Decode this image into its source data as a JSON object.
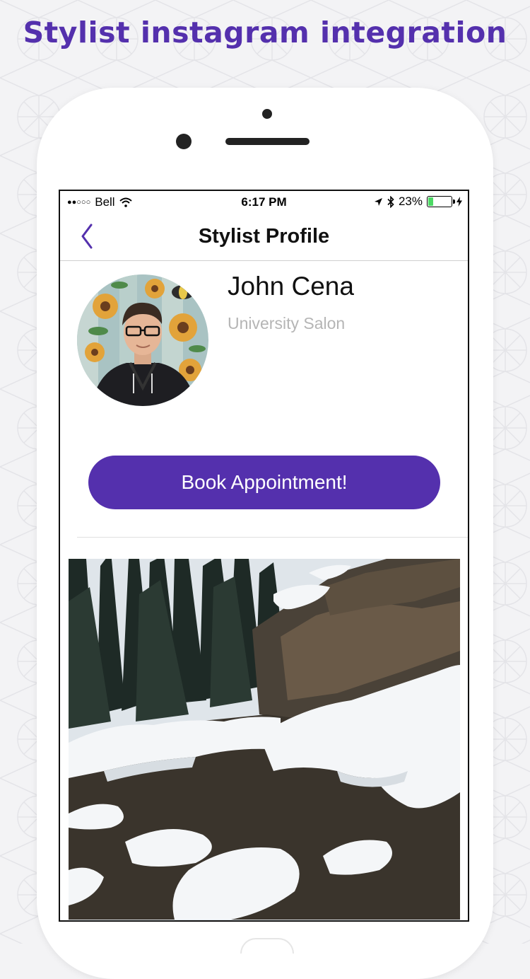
{
  "headline": "Stylist instagram integration",
  "status_bar": {
    "carrier": "Bell",
    "time": "6:17 PM",
    "battery": "23%",
    "battery_level": 0.23
  },
  "nav": {
    "title": "Stylist Profile",
    "back_icon": "chevron-left-icon"
  },
  "profile": {
    "name": "John Cena",
    "salon": "University Salon"
  },
  "book_button": "Book Appointment!",
  "colors": {
    "brand": "#5430ad",
    "battery_green": "#4cd964",
    "muted_text": "#b5b5b5"
  }
}
